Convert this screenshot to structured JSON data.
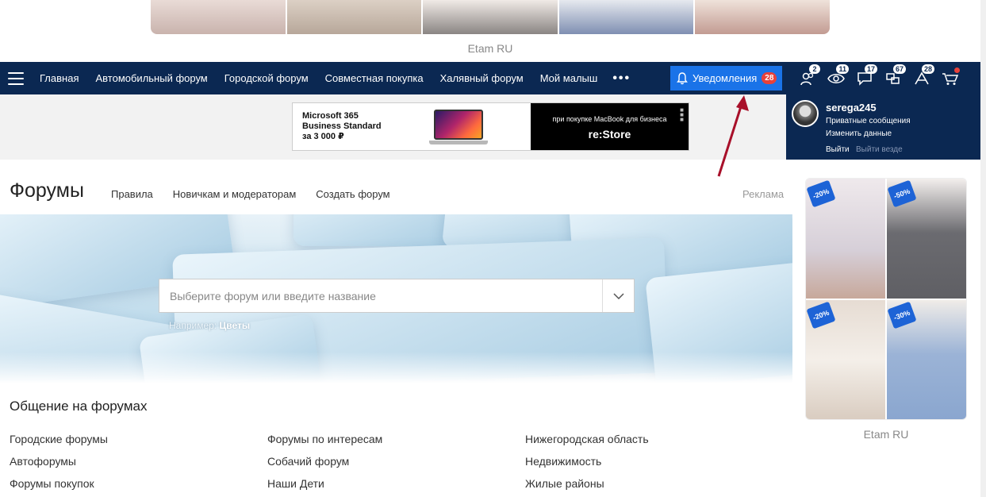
{
  "top_ad": {
    "label": "Etam RU"
  },
  "nav": {
    "items": [
      "Главная",
      "Автомобильный форум",
      "Городской форум",
      "Совместная покупка",
      "Халявный форум",
      "Мой малыш"
    ],
    "more": "•••",
    "notifications": {
      "label": "Уведомления",
      "count": "28"
    },
    "icons": [
      {
        "icon": "friends-icon",
        "count": "2"
      },
      {
        "icon": "eye-icon",
        "count": "11"
      },
      {
        "icon": "messages-icon",
        "count": "17"
      },
      {
        "icon": "forums-icon",
        "count": "67"
      },
      {
        "icon": "answers-icon",
        "count": "28"
      },
      {
        "icon": "cart-icon",
        "count": ""
      }
    ],
    "accent": "#0b2852",
    "button_color": "#1a73e8"
  },
  "banner": {
    "line1": "Microsoft 365",
    "line2": "Business Standard",
    "line3": "за 3 000 ₽",
    "promo": "при покупке MacBook для бизнеса",
    "store": "re:Store"
  },
  "user": {
    "name": "serega245",
    "private_messages": "Приватные сообщения",
    "edit_profile": "Изменить данные",
    "logout": "Выйти",
    "logout_all": "Выйти везде"
  },
  "page": {
    "title": "Форумы",
    "links": [
      "Правила",
      "Новичкам и модераторам",
      "Создать форум"
    ],
    "ad_label": "Реклама"
  },
  "search": {
    "placeholder": "Выберите форум или введите название",
    "example_prefix": "Например:",
    "example_value": "Цветы"
  },
  "forums": {
    "title": "Общение на форумах",
    "columns": [
      [
        "Городские форумы",
        "Автофорумы",
        "Форумы покупок"
      ],
      [
        "Форумы по интересам",
        "Собачий форум",
        "Наши Дети"
      ],
      [
        "Нижегородская область",
        "Недвижимость",
        "Жилые районы"
      ]
    ]
  },
  "right_ad": {
    "tags": [
      "-20%",
      "-50%",
      "-20%",
      "-30%"
    ],
    "label": "Etam RU"
  }
}
